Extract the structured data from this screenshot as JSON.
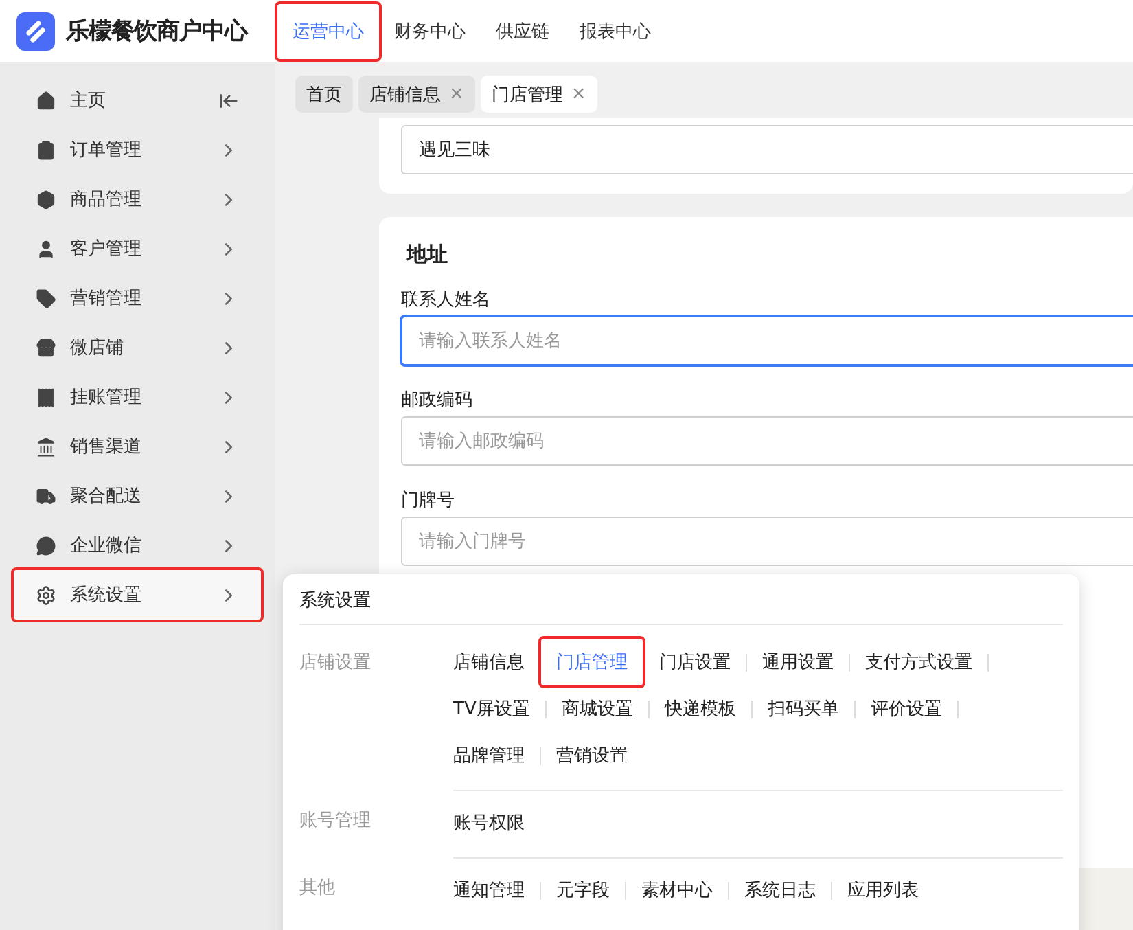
{
  "app": {
    "name": "乐檬餐饮商户中心"
  },
  "top_nav": [
    {
      "label": "运营中心",
      "selected": true,
      "highlighted": true
    },
    {
      "label": "财务中心",
      "selected": false,
      "highlighted": false
    },
    {
      "label": "供应链",
      "selected": false,
      "highlighted": false
    },
    {
      "label": "报表中心",
      "selected": false,
      "highlighted": false
    }
  ],
  "sidebar": {
    "items": [
      {
        "label": "主页",
        "kind": "home",
        "highlighted": false
      },
      {
        "label": "订单管理",
        "kind": "menu",
        "highlighted": false
      },
      {
        "label": "商品管理",
        "kind": "menu",
        "highlighted": false
      },
      {
        "label": "客户管理",
        "kind": "menu",
        "highlighted": false
      },
      {
        "label": "营销管理",
        "kind": "menu",
        "highlighted": false
      },
      {
        "label": "微店铺",
        "kind": "menu",
        "highlighted": false
      },
      {
        "label": "挂账管理",
        "kind": "menu",
        "highlighted": false
      },
      {
        "label": "销售渠道",
        "kind": "menu",
        "highlighted": false
      },
      {
        "label": "聚合配送",
        "kind": "menu",
        "highlighted": false
      },
      {
        "label": "企业微信",
        "kind": "menu",
        "highlighted": false
      },
      {
        "label": "系统设置",
        "kind": "menu",
        "highlighted": true
      }
    ]
  },
  "tabs": [
    {
      "label": "首页",
      "selected": false
    },
    {
      "label": "店铺信息",
      "selected": false,
      "close": "×"
    },
    {
      "label": "门店管理",
      "selected": true,
      "close": "×"
    }
  ],
  "form": {
    "store_name": {
      "value": "遇见三味"
    },
    "address": {
      "title": "地址",
      "fields": [
        {
          "label": "联系人姓名",
          "placeholder": "请输入联系人姓名",
          "focused": true
        },
        {
          "label": "邮政编码",
          "placeholder": "请输入邮政编码",
          "focused": false
        },
        {
          "label": "门牌号",
          "placeholder": "请输入门牌号",
          "focused": false
        }
      ]
    }
  },
  "popup": {
    "title": "系统设置",
    "groups": [
      {
        "label": "店铺设置",
        "items": [
          {
            "label": "店铺信息",
            "selected": false,
            "highlighted": false
          },
          {
            "label": "门店管理",
            "selected": true,
            "highlighted": true
          },
          {
            "label": "门店设置",
            "selected": false,
            "highlighted": false
          },
          {
            "label": "通用设置",
            "selected": false,
            "highlighted": false
          },
          {
            "label": "支付方式设置",
            "selected": false,
            "highlighted": false
          },
          {
            "label": "TV屏设置",
            "selected": false,
            "highlighted": false
          },
          {
            "label": "商城设置",
            "selected": false,
            "highlighted": false
          },
          {
            "label": "快递模板",
            "selected": false,
            "highlighted": false
          },
          {
            "label": "扫码买单",
            "selected": false,
            "highlighted": false
          },
          {
            "label": "评价设置",
            "selected": false,
            "highlighted": false
          },
          {
            "label": "品牌管理",
            "selected": false,
            "highlighted": false
          },
          {
            "label": "营销设置",
            "selected": false,
            "highlighted": false
          }
        ]
      },
      {
        "label": "账号管理",
        "items": [
          {
            "label": "账号权限",
            "selected": false,
            "highlighted": false
          }
        ]
      },
      {
        "label": "其他",
        "items": [
          {
            "label": "通知管理",
            "selected": false,
            "highlighted": false
          },
          {
            "label": "元字段",
            "selected": false,
            "highlighted": false
          },
          {
            "label": "素材中心",
            "selected": false,
            "highlighted": false
          },
          {
            "label": "系统日志",
            "selected": false,
            "highlighted": false
          },
          {
            "label": "应用列表",
            "selected": false,
            "highlighted": false
          }
        ]
      }
    ]
  }
}
